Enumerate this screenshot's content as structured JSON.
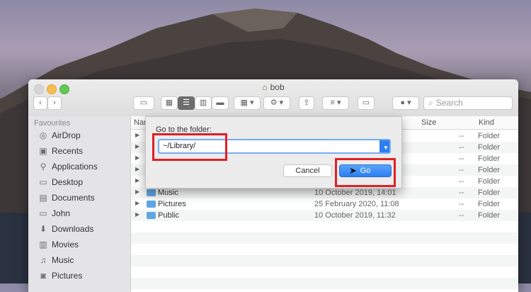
{
  "window": {
    "title": "bob"
  },
  "toolbar": {
    "search_placeholder": "Search"
  },
  "sidebar": {
    "section_title": "Favourites",
    "items": [
      {
        "label": "AirDrop"
      },
      {
        "label": "Recents"
      },
      {
        "label": "Applications"
      },
      {
        "label": "Desktop"
      },
      {
        "label": "Documents"
      },
      {
        "label": "John"
      },
      {
        "label": "Downloads"
      },
      {
        "label": "Movies"
      },
      {
        "label": "Music"
      },
      {
        "label": "Pictures"
      }
    ]
  },
  "file_list": {
    "columns": {
      "name": "Nar",
      "size": "Size",
      "kind": "Kind"
    },
    "rows": [
      {
        "name": "",
        "date": "",
        "size": "--",
        "kind": "Folder"
      },
      {
        "name": "",
        "date": "",
        "size": "--",
        "kind": "Folder"
      },
      {
        "name": "",
        "date": "",
        "size": "--",
        "kind": "Folder"
      },
      {
        "name": "",
        "date": "",
        "size": "--",
        "kind": "Folder"
      },
      {
        "name": "",
        "date": "",
        "size": "--",
        "kind": "Folder"
      },
      {
        "name": "Music",
        "date": "10 October 2019, 14:01",
        "size": "--",
        "kind": "Folder"
      },
      {
        "name": "Pictures",
        "date": "25 February 2020, 11:08",
        "size": "--",
        "kind": "Folder"
      },
      {
        "name": "Public",
        "date": "10 October 2019, 11:32",
        "size": "--",
        "kind": "Folder"
      }
    ]
  },
  "dialog": {
    "label": "Go to the folder:",
    "path_value": "~/Library/",
    "cancel_label": "Cancel",
    "go_label": "Go"
  },
  "colors": {
    "highlight": "#e01f26",
    "accent": "#2a7ef2",
    "folder": "#5fa6e3"
  }
}
